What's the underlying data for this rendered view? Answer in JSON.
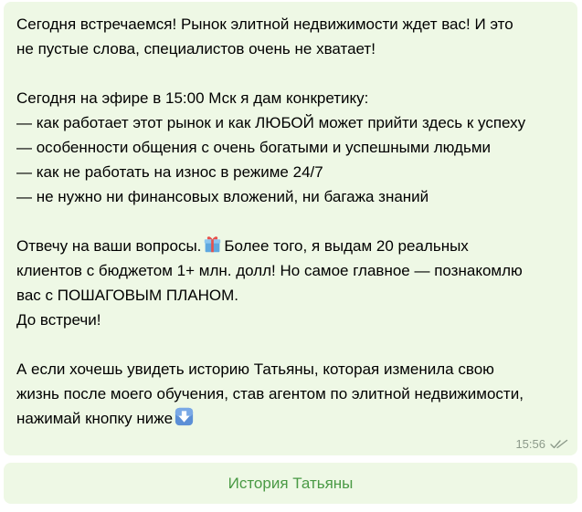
{
  "message": {
    "lines": [
      "Сегодня встречаемся! Рынок элитной недвижимости ждет вас! И это",
      "не пустые слова, специалистов очень не хватает!",
      "",
      "Сегодня на эфире в 15:00 Мск я дам конкретику:",
      "— как работает этот рынок и как ЛЮБОЙ может прийти здесь к успеху",
      "— особенности общения с очень богатыми и успешными людьми",
      "— как не работать на износ в режиме 24/7",
      "— не нужно ни финансовых вложений, ни багажа знаний",
      "",
      "Отвечу на ваши вопросы.",
      "клиентов с бюджетом 1+ млн. долл! Но самое главное — познакомлю",
      "вас с ПОШАГОВЫМ ПЛАНОМ.",
      "До встречи!",
      "",
      "А если хочешь увидеть историю Татьяны, которая изменила свою",
      "жизнь после моего обучения, став агентом по элитной недвижимости,",
      "нажимай кнопку ниже"
    ],
    "gift_line_tail": "Более того, я выдам 20 реальных",
    "gift_emoji": "gift-icon",
    "arrow_emoji": "down-arrow-icon",
    "time": "15:56",
    "read_status": "double-check-icon"
  },
  "inline_button": {
    "label": "История Татьяны"
  },
  "colors": {
    "bubble_bg": "#eef8e5",
    "button_text": "#4a9a45",
    "meta_text": "#8c9a8a"
  }
}
